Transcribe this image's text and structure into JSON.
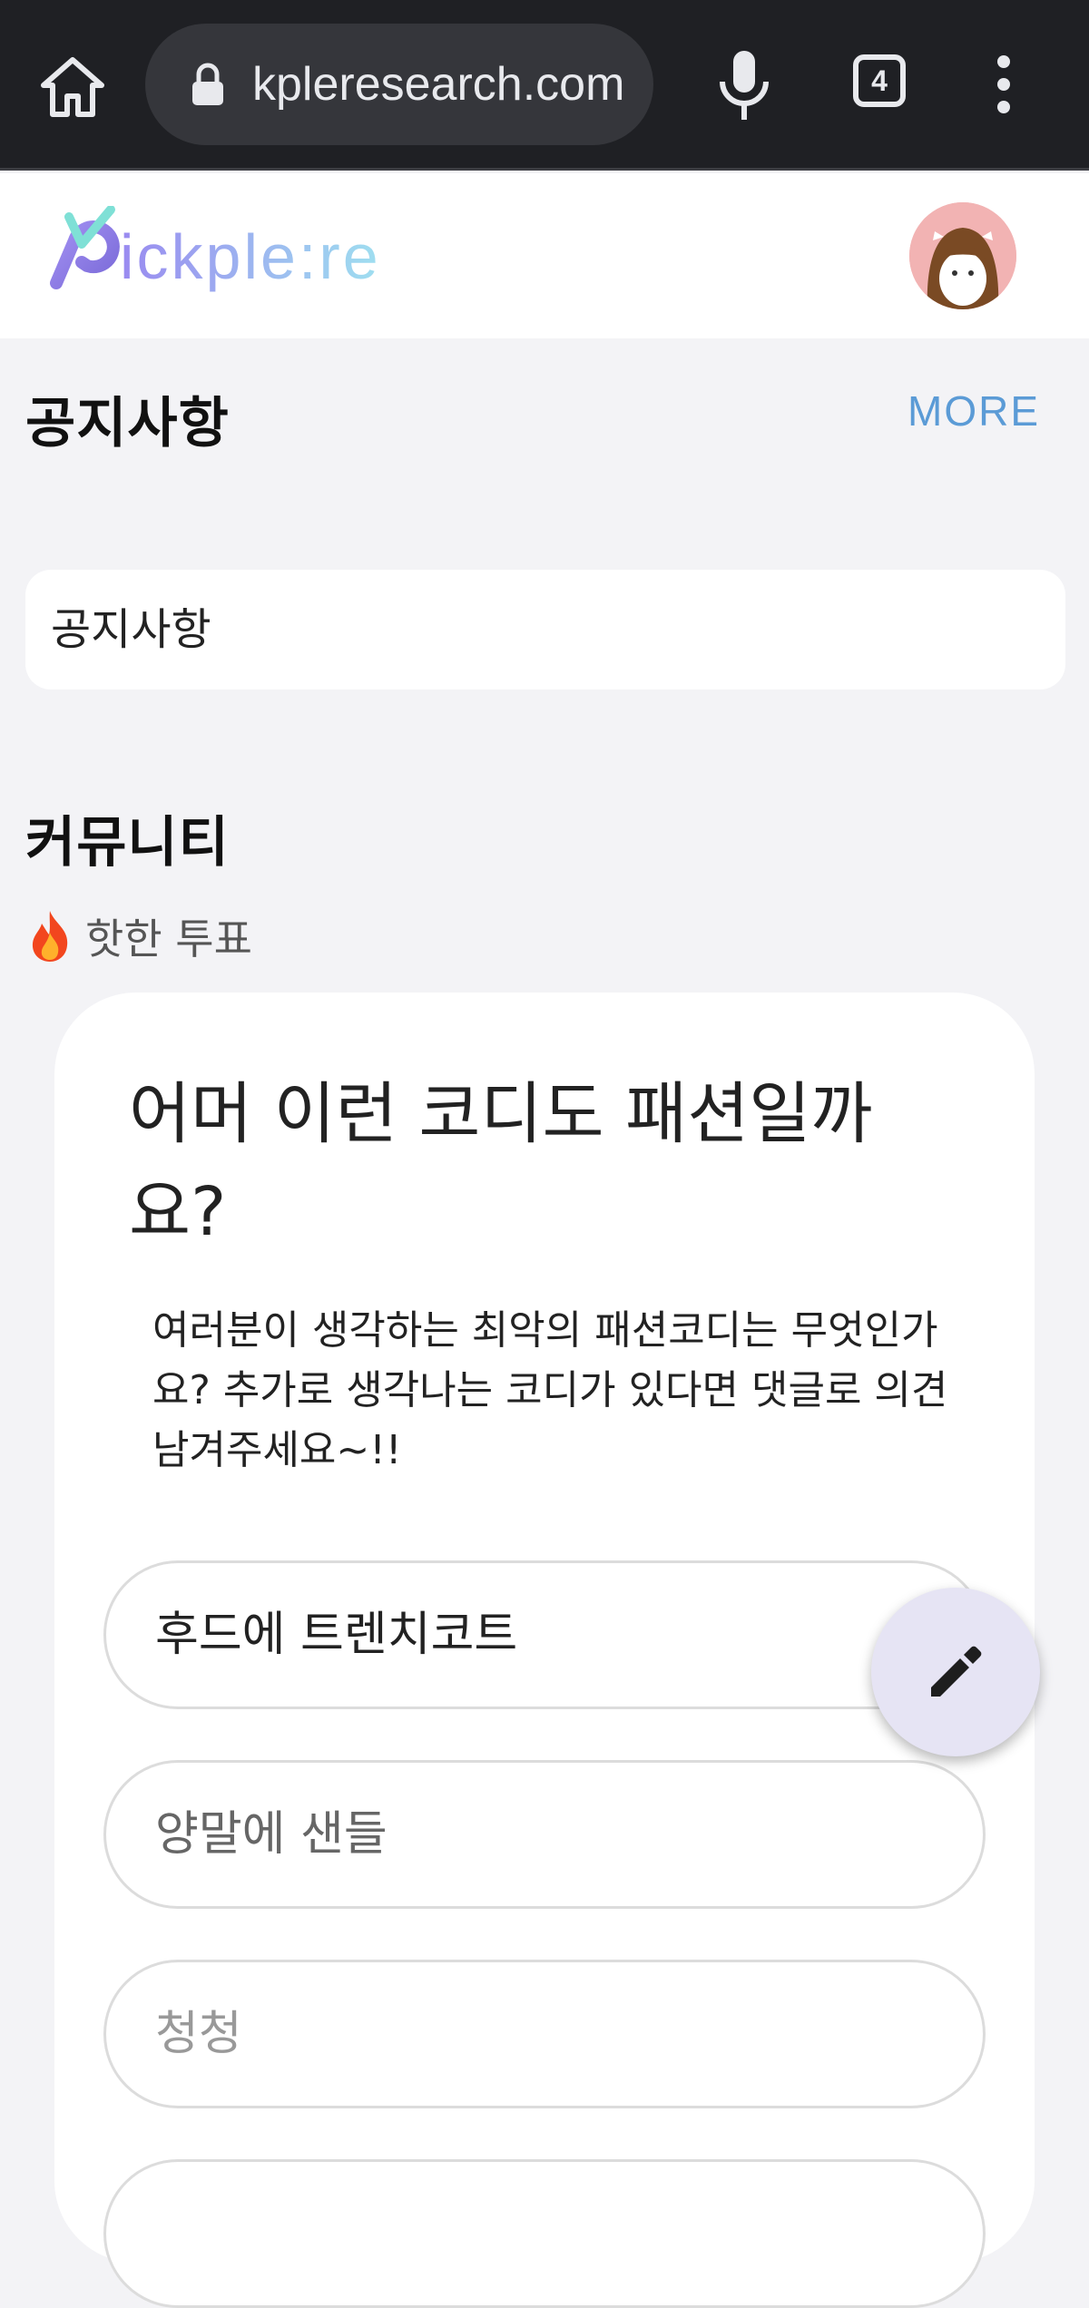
{
  "browser": {
    "url": "kpleresearch.com",
    "tab_count": "4"
  },
  "header": {
    "logo_text": "pickple:re"
  },
  "notice": {
    "section_title": "공지사항",
    "more_label": "MORE",
    "card_text": "공지사항"
  },
  "community": {
    "section_title": "커뮤니티",
    "hot_label": "핫한 투표",
    "poll": {
      "title": "어머 이런 코디도 패션일까요?",
      "description": "여러분이 생각하는 최악의 패션코디는 무엇인가요? 추가로 생각나는 코디가 있다면 댓글로 의견 남겨주세요~!!",
      "options": [
        {
          "label": "후드에 트렌치코트",
          "color": "#222222"
        },
        {
          "label": "양말에 샌들",
          "color": "#666666"
        },
        {
          "label": "청청",
          "color": "#999999"
        }
      ]
    }
  },
  "colors": {
    "browser_bg": "#1f2024",
    "page_bg": "#f3f3f6",
    "accent_link": "#5b9bd6",
    "fab_bg": "#e6e4f4"
  }
}
